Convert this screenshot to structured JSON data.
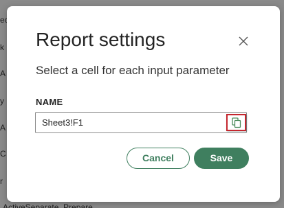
{
  "background": {
    "fragments": [
      "ec",
      "k",
      "A",
      "y",
      "A",
      "C",
      "r",
      "ActiveSeparate_Prepare"
    ]
  },
  "dialog": {
    "title": "Report settings",
    "close_icon": "close-icon",
    "subtitle": "Select a cell for each input parameter",
    "field": {
      "label": "NAME",
      "value": "Sheet3!F1",
      "action_icon": "copy-icon"
    },
    "cancel_label": "Cancel",
    "save_label": "Save"
  },
  "colors": {
    "accent": "#3f7f5f",
    "highlight_border": "#c4262e"
  }
}
